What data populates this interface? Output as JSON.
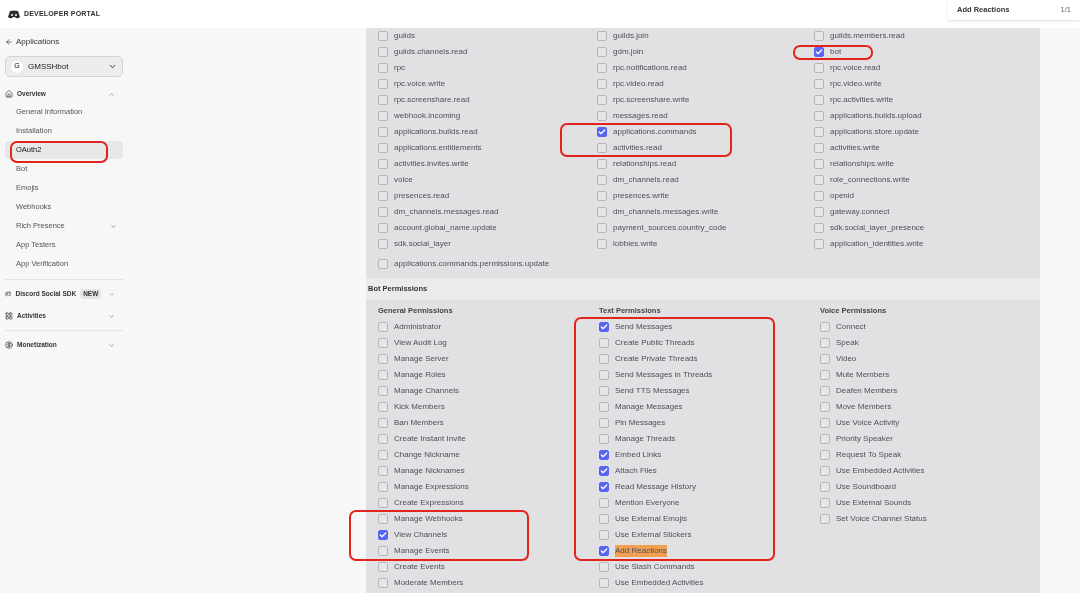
{
  "header": {
    "title": "DEVELOPER PORTAL"
  },
  "find_bar": {
    "query": "Add Reactions",
    "count": "1/1"
  },
  "sidebar": {
    "back_link": "Applications",
    "app_selector": {
      "avatar": "G",
      "name": "GMSSHbot"
    },
    "sections": [
      {
        "kind": "overview",
        "label": "Overview",
        "expanded": true,
        "items": [
          {
            "label": "General Information",
            "selected": false,
            "expandable": false
          },
          {
            "label": "Installation",
            "selected": false,
            "expandable": false
          },
          {
            "label": "OAuth2",
            "selected": true,
            "expandable": false
          },
          {
            "label": "Bot",
            "selected": false,
            "expandable": false
          },
          {
            "label": "Emojis",
            "selected": false,
            "expandable": false
          },
          {
            "label": "Webhooks",
            "selected": false,
            "expandable": false
          },
          {
            "label": "Rich Presence",
            "selected": false,
            "expandable": true
          },
          {
            "label": "App Testers",
            "selected": false,
            "expandable": false
          },
          {
            "label": "App Verification",
            "selected": false,
            "expandable": false
          }
        ]
      },
      {
        "kind": "sdk",
        "label": "Discord Social SDK",
        "badge": "NEW",
        "expanded": false
      },
      {
        "kind": "activities",
        "label": "Activities",
        "expanded": false
      },
      {
        "kind": "monetization",
        "label": "Monetization",
        "expanded": false
      }
    ]
  },
  "scopes": {
    "items": [
      {
        "label": "guilds",
        "checked": false
      },
      {
        "label": "guilds.join",
        "checked": false
      },
      {
        "label": "guilds.members.read",
        "checked": false
      },
      {
        "label": "guilds.channels.read",
        "checked": false
      },
      {
        "label": "gdm.join",
        "checked": false
      },
      {
        "label": "bot",
        "checked": true
      },
      {
        "label": "rpc",
        "checked": false
      },
      {
        "label": "rpc.notifications.read",
        "checked": false
      },
      {
        "label": "rpc.voice.read",
        "checked": false
      },
      {
        "label": "rpc.voice.write",
        "checked": false
      },
      {
        "label": "rpc.video.read",
        "checked": false
      },
      {
        "label": "rpc.video.write",
        "checked": false
      },
      {
        "label": "rpc.screenshare.read",
        "checked": false
      },
      {
        "label": "rpc.screenshare.write",
        "checked": false
      },
      {
        "label": "rpc.activities.write",
        "checked": false
      },
      {
        "label": "webhook.incoming",
        "checked": false
      },
      {
        "label": "messages.read",
        "checked": false
      },
      {
        "label": "applications.builds.upload",
        "checked": false
      },
      {
        "label": "applications.builds.read",
        "checked": false
      },
      {
        "label": "applications.commands",
        "checked": true
      },
      {
        "label": "applications.store.update",
        "checked": false
      },
      {
        "label": "applications.entitlements",
        "checked": false
      },
      {
        "label": "activities.read",
        "checked": false
      },
      {
        "label": "activities.write",
        "checked": false
      },
      {
        "label": "activities.invites.write",
        "checked": false
      },
      {
        "label": "relationships.read",
        "checked": false
      },
      {
        "label": "relationships.write",
        "checked": false
      },
      {
        "label": "voice",
        "checked": false
      },
      {
        "label": "dm_channels.read",
        "checked": false
      },
      {
        "label": "role_connections.write",
        "checked": false
      },
      {
        "label": "presences.read",
        "checked": false
      },
      {
        "label": "presences.write",
        "checked": false
      },
      {
        "label": "openid",
        "checked": false
      },
      {
        "label": "dm_channels.messages.read",
        "checked": false
      },
      {
        "label": "dm_channels.messages.write",
        "checked": false
      },
      {
        "label": "gateway.connect",
        "checked": false
      },
      {
        "label": "account.global_name.update",
        "checked": false
      },
      {
        "label": "payment_sources.country_code",
        "checked": false
      },
      {
        "label": "sdk.social_layer_presence",
        "checked": false
      },
      {
        "label": "sdk.social_layer",
        "checked": false
      },
      {
        "label": "lobbies.write",
        "checked": false
      },
      {
        "label": "application_identities.write",
        "checked": false
      }
    ],
    "extra_items": [
      {
        "label": "applications.commands.permissions.update",
        "checked": false
      }
    ]
  },
  "bot_permissions": {
    "title": "Bot Permissions",
    "groups": [
      {
        "title": "General Permissions",
        "items": [
          {
            "label": "Administrator",
            "checked": false,
            "highlighted": false
          },
          {
            "label": "View Audit Log",
            "checked": false,
            "highlighted": false
          },
          {
            "label": "Manage Server",
            "checked": false,
            "highlighted": false
          },
          {
            "label": "Manage Roles",
            "checked": false,
            "highlighted": false
          },
          {
            "label": "Manage Channels",
            "checked": false,
            "highlighted": false
          },
          {
            "label": "Kick Members",
            "checked": false,
            "highlighted": false
          },
          {
            "label": "Ban Members",
            "checked": false,
            "highlighted": false
          },
          {
            "label": "Create Instant Invite",
            "checked": false,
            "highlighted": false
          },
          {
            "label": "Change Nickname",
            "checked": false,
            "highlighted": false
          },
          {
            "label": "Manage Nicknames",
            "checked": false,
            "highlighted": false
          },
          {
            "label": "Manage Expressions",
            "checked": false,
            "highlighted": false
          },
          {
            "label": "Create Expressions",
            "checked": false,
            "highlighted": false
          },
          {
            "label": "Manage Webhooks",
            "checked": false,
            "highlighted": false
          },
          {
            "label": "View Channels",
            "checked": true,
            "highlighted": false
          },
          {
            "label": "Manage Events",
            "checked": false,
            "highlighted": false
          },
          {
            "label": "Create Events",
            "checked": false,
            "highlighted": false
          },
          {
            "label": "Moderate Members",
            "checked": false,
            "highlighted": false
          }
        ]
      },
      {
        "title": "Text Permissions",
        "items": [
          {
            "label": "Send Messages",
            "checked": true,
            "highlighted": false
          },
          {
            "label": "Create Public Threads",
            "checked": false,
            "highlighted": false
          },
          {
            "label": "Create Private Threads",
            "checked": false,
            "highlighted": false
          },
          {
            "label": "Send Messages in Threads",
            "checked": false,
            "highlighted": false
          },
          {
            "label": "Send TTS Messages",
            "checked": false,
            "highlighted": false
          },
          {
            "label": "Manage Messages",
            "checked": false,
            "highlighted": false
          },
          {
            "label": "Pin Messages",
            "checked": false,
            "highlighted": false
          },
          {
            "label": "Manage Threads",
            "checked": false,
            "highlighted": false
          },
          {
            "label": "Embed Links",
            "checked": true,
            "highlighted": false
          },
          {
            "label": "Attach Files",
            "checked": true,
            "highlighted": false
          },
          {
            "label": "Read Message History",
            "checked": true,
            "highlighted": false
          },
          {
            "label": "Mention Everyone",
            "checked": false,
            "highlighted": false
          },
          {
            "label": "Use External Emojis",
            "checked": false,
            "highlighted": false
          },
          {
            "label": "Use External Stickers",
            "checked": false,
            "highlighted": false
          },
          {
            "label": "Add Reactions",
            "checked": true,
            "highlighted": true
          },
          {
            "label": "Use Slash Commands",
            "checked": false,
            "highlighted": false
          },
          {
            "label": "Use Embedded Activities",
            "checked": false,
            "highlighted": false
          }
        ]
      },
      {
        "title": "Voice Permissions",
        "items": [
          {
            "label": "Connect",
            "checked": false,
            "highlighted": false
          },
          {
            "label": "Speak",
            "checked": false,
            "highlighted": false
          },
          {
            "label": "Video",
            "checked": false,
            "highlighted": false
          },
          {
            "label": "Mute Members",
            "checked": false,
            "highlighted": false
          },
          {
            "label": "Deafen Members",
            "checked": false,
            "highlighted": false
          },
          {
            "label": "Move Members",
            "checked": false,
            "highlighted": false
          },
          {
            "label": "Use Voice Activity",
            "checked": false,
            "highlighted": false
          },
          {
            "label": "Priority Speaker",
            "checked": false,
            "highlighted": false
          },
          {
            "label": "Request To Speak",
            "checked": false,
            "highlighted": false
          },
          {
            "label": "Use Embedded Activities",
            "checked": false,
            "highlighted": false
          },
          {
            "label": "Use Soundboard",
            "checked": false,
            "highlighted": false
          },
          {
            "label": "Use External Sounds",
            "checked": false,
            "highlighted": false
          },
          {
            "label": "Set Voice Channel Status",
            "checked": false,
            "highlighted": false
          }
        ]
      }
    ]
  }
}
